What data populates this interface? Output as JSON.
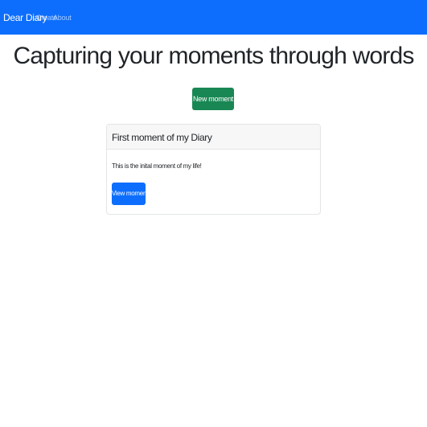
{
  "navbar": {
    "brand": "Dear Diary",
    "links": [
      {
        "label": "Create"
      },
      {
        "label": "About"
      }
    ]
  },
  "hero": {
    "title": "Capturing your moments through words"
  },
  "actions": {
    "new_moment_label": "New moment"
  },
  "moments": [
    {
      "title": "First moment of my Diary",
      "body": "This is the inital moment of my life!",
      "view_label": "View moment"
    }
  ],
  "colors": {
    "navbar_bg": "#0d6efd",
    "primary_button": "#0d6efd",
    "success_button": "#198754",
    "card_header_bg": "#f7f7f7"
  }
}
